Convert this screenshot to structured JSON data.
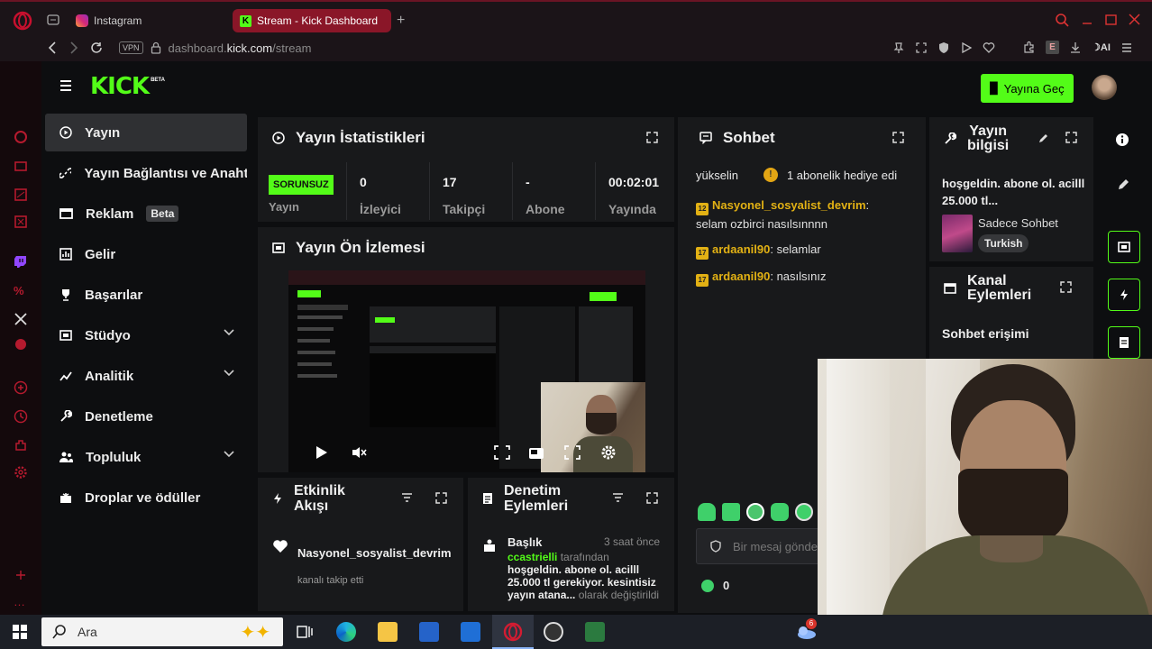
{
  "browser": {
    "tabs": [
      {
        "label": "Instagram"
      },
      {
        "label": "Stream - Kick Dashboard"
      }
    ],
    "address": {
      "vpn": "VPN",
      "prefix": "dashboard.",
      "domain": "kick.com",
      "path": "/stream"
    },
    "ai_label": "AI"
  },
  "header": {
    "logo": "KICK",
    "logo_badge": "BETA",
    "go_live": "Yayına Geç"
  },
  "sidebar": {
    "items": [
      {
        "label": "Yayın",
        "icon": "play-circle-icon"
      },
      {
        "label": "Yayın Bağlantısı ve Anahtarı",
        "icon": "link-icon"
      },
      {
        "label": "Reklam",
        "badge": "Beta",
        "icon": "ad-icon"
      },
      {
        "label": "Gelir",
        "icon": "revenue-icon"
      },
      {
        "label": "Başarılar",
        "icon": "trophy-icon"
      },
      {
        "label": "Stüdyo",
        "icon": "studio-icon"
      },
      {
        "label": "Analitik",
        "icon": "analytics-icon"
      },
      {
        "label": "Denetleme",
        "icon": "wrench-icon"
      },
      {
        "label": "Topluluk",
        "icon": "community-icon"
      },
      {
        "label": "Droplar ve ödüller",
        "icon": "gift-icon"
      }
    ]
  },
  "stats": {
    "title": "Yayın İstatistikleri",
    "status_badge": "SORUNSUZ",
    "status_label": "Yayın",
    "items": [
      {
        "value": "0",
        "label": "İzleyici"
      },
      {
        "value": "17",
        "label": "Takipçi"
      },
      {
        "value": "-",
        "label": "Abone"
      },
      {
        "value": "00:02:01",
        "label": "Yayında"
      }
    ]
  },
  "preview": {
    "title": "Yayın Ön İzlemesi"
  },
  "chat": {
    "title": "Sohbet",
    "pinned_left": "yükselin",
    "pinned_right": "1 abonelik hediye edi",
    "messages": [
      {
        "badge": "12",
        "user": "Nasyonel_sosyalist_devrim",
        "sep": ":",
        "text": "selam ozbirci nasılsınnnn"
      },
      {
        "badge": "17",
        "user": "ardaanil90",
        "sep": ":",
        "text": " selamlar"
      },
      {
        "badge": "17",
        "user": "ardaanil90",
        "sep": ":",
        "text": " nasılsınız"
      }
    ],
    "input_placeholder": "Bir mesaj gönder",
    "points": "0"
  },
  "stream_info": {
    "title_line1": "Yayın",
    "title_line2": "bilgisi",
    "stream_title": "hoşgeldin. abone ol. acilll 25.000 tl...",
    "category": "Sadece Sohbet",
    "tag": "Turkish"
  },
  "channel_actions": {
    "title_line1": "Kanal",
    "title_line2": "Eylemleri",
    "item": "Sohbet erişimi"
  },
  "activity": {
    "title_line1": "Etkinlik",
    "title_line2": "Akışı",
    "user": "Nasyonel_sosyalist_devrim",
    "action": "kanalı takip etti"
  },
  "moderation": {
    "title_line1": "Denetim",
    "title_line2": "Eylemleri",
    "heading": "Başlık",
    "time": "3 saat önce",
    "mod": "ccastrielli",
    "by": " tarafından ",
    "new_title": "hoşgeldin. abone ol. acilll 25.000 tl gerekiyor. kesintisiz yayın atana...",
    "suffix": " olarak değiştirildi"
  },
  "taskbar": {
    "search": "Ara",
    "notif": "6"
  },
  "colors": {
    "kick_green": "#53fc18",
    "opera_red": "#c8102e",
    "sub_gold": "#e2b114",
    "chat_green": "#3fd06a"
  }
}
